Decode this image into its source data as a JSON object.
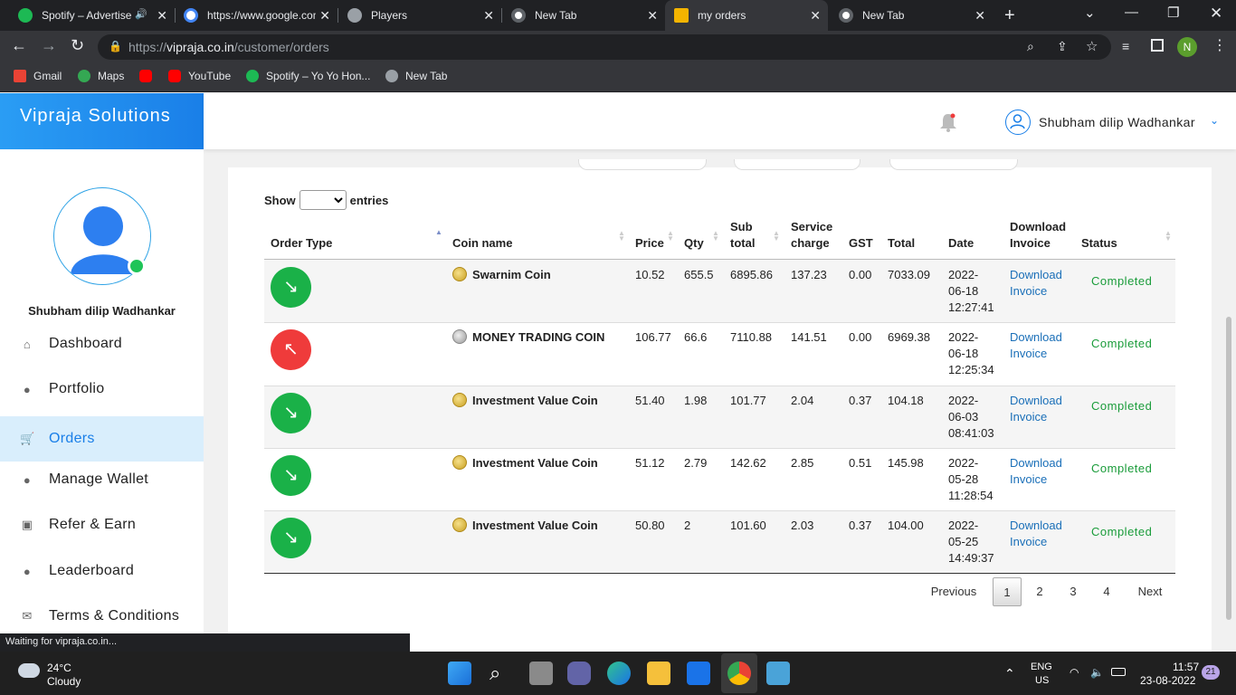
{
  "browser": {
    "tabs": [
      {
        "title": "Spotify – Advertisement",
        "color": "#1db954"
      },
      {
        "title": "https://www.google.com",
        "color": "#4285f4"
      },
      {
        "title": "Players",
        "color": "#9aa0a6"
      },
      {
        "title": "New Tab",
        "color": "#9aa0a6"
      },
      {
        "title": "my orders",
        "color": "#f4b400"
      },
      {
        "title": "New Tab",
        "color": "#9aa0a6"
      }
    ],
    "url_prefix": "https://",
    "url_host": "vipraja.co.in",
    "url_path": "/customer/orders",
    "profile_initial": "N",
    "bookmarks": [
      {
        "label": "Gmail",
        "color": "#ea4335"
      },
      {
        "label": "Maps",
        "color": "#34a853"
      },
      {
        "label": "",
        "color": "#ff0000"
      },
      {
        "label": "YouTube",
        "color": "#ff0000"
      },
      {
        "label": "Spotify – Yo Yo Hon...",
        "color": "#1db954"
      },
      {
        "label": "New Tab",
        "color": "#9aa0a6"
      }
    ],
    "status_text": "Waiting for vipraja.co.in..."
  },
  "app": {
    "brand": "Vipraja Solutions",
    "user_name": "Shubham dilip Wadhankar",
    "sidebar_user_name": "Shubham dilip Wadhankar",
    "nav": [
      {
        "label": "Dashboard",
        "icon": "home-icon"
      },
      {
        "label": "Portfolio",
        "icon": "user-icon"
      },
      {
        "label": "Orders",
        "icon": "cart-icon",
        "active": true
      },
      {
        "label": "Manage Wallet",
        "icon": "user-icon"
      },
      {
        "label": "Refer & Earn",
        "icon": "money-icon"
      },
      {
        "label": "Leaderboard",
        "icon": "user-icon"
      },
      {
        "label": "Terms & Conditions",
        "icon": "envelope-icon"
      }
    ]
  },
  "orders": {
    "show_label": "Show",
    "entries_label": "entries",
    "columns": [
      "Order Type",
      "Coin name",
      "Price",
      "Qty",
      "Sub total",
      "Service charge",
      "GST",
      "Total",
      "Date",
      "Download Invoice",
      "Status"
    ],
    "col_sub_1": "Sub",
    "col_sub_2": "total",
    "col_svc_1": "Service",
    "col_svc_2": "charge",
    "col_dl_1": "Download",
    "col_dl_2": "Invoice",
    "rows": [
      {
        "type": "buy",
        "coin": "Swarnim Coin",
        "price": "10.52",
        "qty": "655.5",
        "subtotal": "6895.86",
        "service": "137.23",
        "gst": "0.00",
        "total": "7033.09",
        "date1": "2022-",
        "date2": "06-18",
        "date3": "12:27:41",
        "dl1": "Download",
        "dl2": "Invoice",
        "status": "Completed"
      },
      {
        "type": "sell",
        "coin": "MONEY TRADING COIN",
        "price": "106.77",
        "qty": "66.6",
        "subtotal": "7110.88",
        "service": "141.51",
        "gst": "0.00",
        "total": "6969.38",
        "date1": "2022-",
        "date2": "06-18",
        "date3": "12:25:34",
        "dl1": "Download",
        "dl2": "Invoice",
        "status": "Completed"
      },
      {
        "type": "buy",
        "coin": "Investment Value Coin",
        "price": "51.40",
        "qty": "1.98",
        "subtotal": "101.77",
        "service": "2.04",
        "gst": "0.37",
        "total": "104.18",
        "date1": "2022-",
        "date2": "06-03",
        "date3": "08:41:03",
        "dl1": "Download",
        "dl2": "Invoice",
        "status": "Completed"
      },
      {
        "type": "buy",
        "coin": "Investment Value Coin",
        "price": "51.12",
        "qty": "2.79",
        "subtotal": "142.62",
        "service": "2.85",
        "gst": "0.51",
        "total": "145.98",
        "date1": "2022-",
        "date2": "05-28",
        "date3": "11:28:54",
        "dl1": "Download",
        "dl2": "Invoice",
        "status": "Completed"
      },
      {
        "type": "buy",
        "coin": "Investment Value Coin",
        "price": "50.80",
        "qty": "2",
        "subtotal": "101.60",
        "service": "2.03",
        "gst": "0.37",
        "total": "104.00",
        "date1": "2022-",
        "date2": "05-25",
        "date3": "14:49:37",
        "dl1": "Download",
        "dl2": "Invoice",
        "status": "Completed"
      }
    ],
    "pagination": {
      "previous": "Previous",
      "pages": [
        "1",
        "2",
        "3",
        "4"
      ],
      "current": "1",
      "next": "Next"
    }
  },
  "taskbar": {
    "weather_temp": "24°C",
    "weather_desc": "Cloudy",
    "lang1": "ENG",
    "lang2": "US",
    "time": "11:57",
    "date": "23-08-2022",
    "notif_count": "21"
  }
}
